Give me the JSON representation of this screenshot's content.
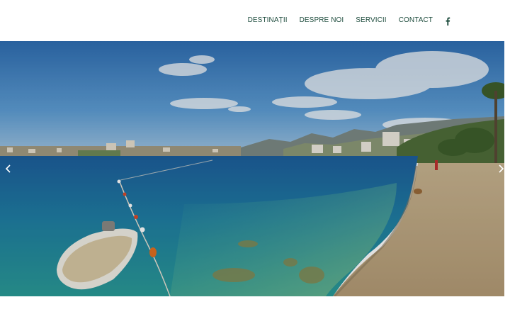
{
  "header": {
    "nav": [
      {
        "label": "DESTINAȚII"
      },
      {
        "label": "DESPRE NOI"
      },
      {
        "label": "SERVICII"
      },
      {
        "label": "CONTACT"
      }
    ],
    "social_icon": "facebook-icon"
  },
  "hero": {
    "prev_icon": "chevron-left-icon",
    "next_icon": "chevron-right-icon"
  },
  "colors": {
    "nav_text": "#1f4d3e",
    "background": "#ffffff"
  }
}
